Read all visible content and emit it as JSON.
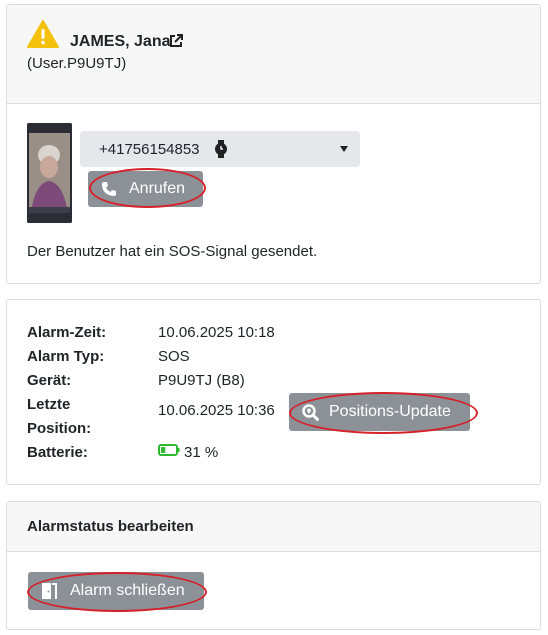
{
  "user": {
    "name": "JAMES, Jana",
    "id": "(User.P9U9TJ)",
    "phone": "+41756154853",
    "call_label": "Anrufen",
    "message": "Der Benutzer hat ein SOS-Signal gesendet."
  },
  "details": {
    "alarm_time_label": "Alarm-Zeit:",
    "alarm_time": "10.06.2025 10:18",
    "alarm_type_label": "Alarm Typ:",
    "alarm_type": "SOS",
    "device_label": "Gerät:",
    "device": "P9U9TJ (B8)",
    "last_position_label_1": "Letzte",
    "last_position_label_2": "Position:",
    "last_position": "10.06.2025 10:36",
    "position_update_label": "Positions-Update",
    "battery_label": "Batterie:",
    "battery": "31 %",
    "battery_level": 0.31
  },
  "alarm_status": {
    "title": "Alarmstatus bearbeiten",
    "close_label": "Alarm schließen"
  },
  "colors": {
    "warning": "#f4c20d",
    "button": "#8c9198",
    "highlight": "#d6202a",
    "battery": "#2eb82e"
  },
  "icons": [
    "warning-icon",
    "external-link-icon",
    "smartwatch-icon",
    "dropdown-caret-icon",
    "phone-icon",
    "search-location-icon",
    "battery-icon",
    "door-exit-icon"
  ]
}
